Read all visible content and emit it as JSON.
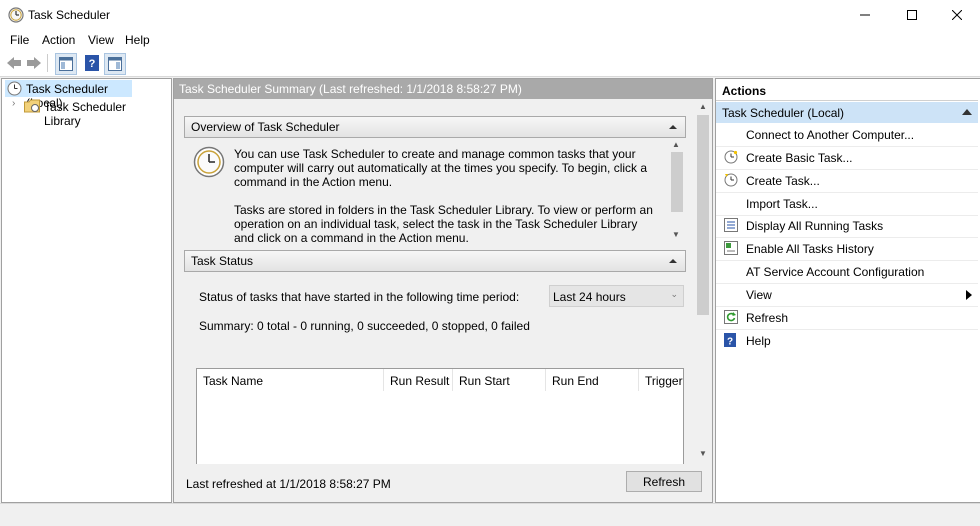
{
  "window": {
    "title": "Task Scheduler"
  },
  "menu": [
    "File",
    "Action",
    "View",
    "Help"
  ],
  "tree": {
    "root": "Task Scheduler (Local)",
    "child": "Task Scheduler Library"
  },
  "center": {
    "header": "Task Scheduler Summary (Last refreshed: 1/1/2018 8:58:27 PM)",
    "overview": {
      "title": "Overview of Task Scheduler",
      "para1": "You can use Task Scheduler to create and manage common tasks that your computer will carry out automatically at the times you specify. To begin, click a command in the Action menu.",
      "para2": "Tasks are stored in folders in the Task Scheduler Library. To view or perform an operation on an individual task, select the task in the Task Scheduler Library and click on a command in the Action menu."
    },
    "status": {
      "title": "Task Status",
      "period_label": "Status of tasks that have started in the following time period:",
      "period_value": "Last 24 hours",
      "summary": "Summary: 0 total - 0 running, 0 succeeded, 0 stopped, 0 failed",
      "columns": [
        "Task Name",
        "Run Result",
        "Run Start",
        "Run End",
        "Trigger"
      ]
    },
    "footer": {
      "last_refreshed": "Last refreshed at 1/1/2018 8:58:27 PM",
      "refresh_button": "Refresh"
    }
  },
  "actions": {
    "title": "Actions",
    "group": "Task Scheduler (Local)",
    "items": [
      {
        "label": "Connect to Another Computer...",
        "icon": "none"
      },
      {
        "label": "Create Basic Task...",
        "icon": "clock-wand-icon"
      },
      {
        "label": "Create Task...",
        "icon": "new-task-icon"
      },
      {
        "label": "Import Task...",
        "icon": "none"
      },
      {
        "label": "Display All Running Tasks",
        "icon": "list-icon"
      },
      {
        "label": "Enable All Tasks History",
        "icon": "history-icon"
      },
      {
        "label": "AT Service Account Configuration",
        "icon": "none"
      },
      {
        "label": "View",
        "icon": "none"
      },
      {
        "label": "Refresh",
        "icon": "refresh-icon"
      },
      {
        "label": "Help",
        "icon": "help-icon"
      }
    ]
  }
}
